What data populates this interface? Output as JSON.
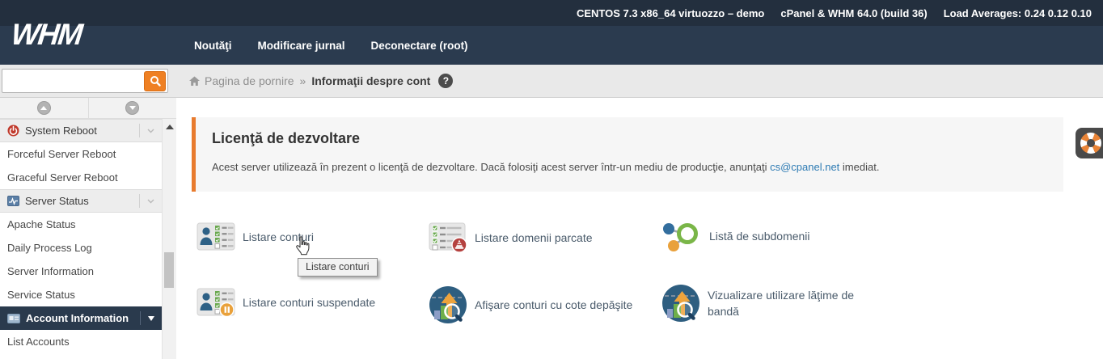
{
  "topbar": {
    "system": "CENTOS 7.3 x86_64 virtuozzo – demo",
    "version": "cPanel & WHM 64.0 (build 36)",
    "load": "Load Averages: 0.24 0.12 0.10"
  },
  "header": {
    "logo": "WHM",
    "nav": [
      "Noutăţi",
      "Modificare jurnal",
      "Deconectare (root)"
    ]
  },
  "search": {
    "value": "",
    "placeholder": "",
    "icon": "search-icon"
  },
  "breadcrumb": {
    "home_icon": "home-icon",
    "home": "Pagina de pornire",
    "separator": "»",
    "current": "Informaţii despre cont",
    "help": "?"
  },
  "sidebar": {
    "items": [
      {
        "type": "header",
        "label": "System Reboot",
        "icon": "power-icon"
      },
      {
        "type": "link",
        "label": "Forceful Server Reboot"
      },
      {
        "type": "link",
        "label": "Graceful Server Reboot"
      },
      {
        "type": "header",
        "label": "Server Status",
        "icon": "status-graph-icon"
      },
      {
        "type": "link",
        "label": "Apache Status"
      },
      {
        "type": "link",
        "label": "Daily Process Log"
      },
      {
        "type": "link",
        "label": "Server Information"
      },
      {
        "type": "link",
        "label": "Service Status"
      },
      {
        "type": "header-active",
        "label": "Account Information",
        "icon": "id-card-icon"
      },
      {
        "type": "link",
        "label": "List Accounts"
      }
    ]
  },
  "main": {
    "license": {
      "title": "Licenţă de dezvoltare",
      "body_before_link": "Acest server utilizează în prezent o licenţă de dezvoltare. Dacă folosiţi acest server într-un mediu de producţie, anunţaţi ",
      "link": "cs@cpanel.net",
      "body_after_link": " imediat."
    },
    "grid": [
      {
        "label": "Listare conturi",
        "icon": "account-list-icon"
      },
      {
        "label": "Listare domenii parcate",
        "icon": "parked-domains-icon"
      },
      {
        "label": "Listă de subdomenii",
        "icon": "subdomains-icon"
      },
      {
        "label": "Listare conturi suspendate",
        "icon": "suspended-accounts-icon"
      },
      {
        "label": "Afişare conturi cu cote depăşite",
        "icon": "quota-exceeded-icon"
      },
      {
        "label": "Vizualizare utilizare lăţime de bandă",
        "icon": "bandwidth-usage-icon"
      }
    ],
    "tooltip": "Listare conturi"
  },
  "colors": {
    "accent_orange": "#e87b2e",
    "masthead_navy": "#2b3b4f",
    "topstrip_navy": "#232f3e",
    "active_item_navy": "#2a3a4d",
    "link_blue": "#2f7cb4"
  }
}
